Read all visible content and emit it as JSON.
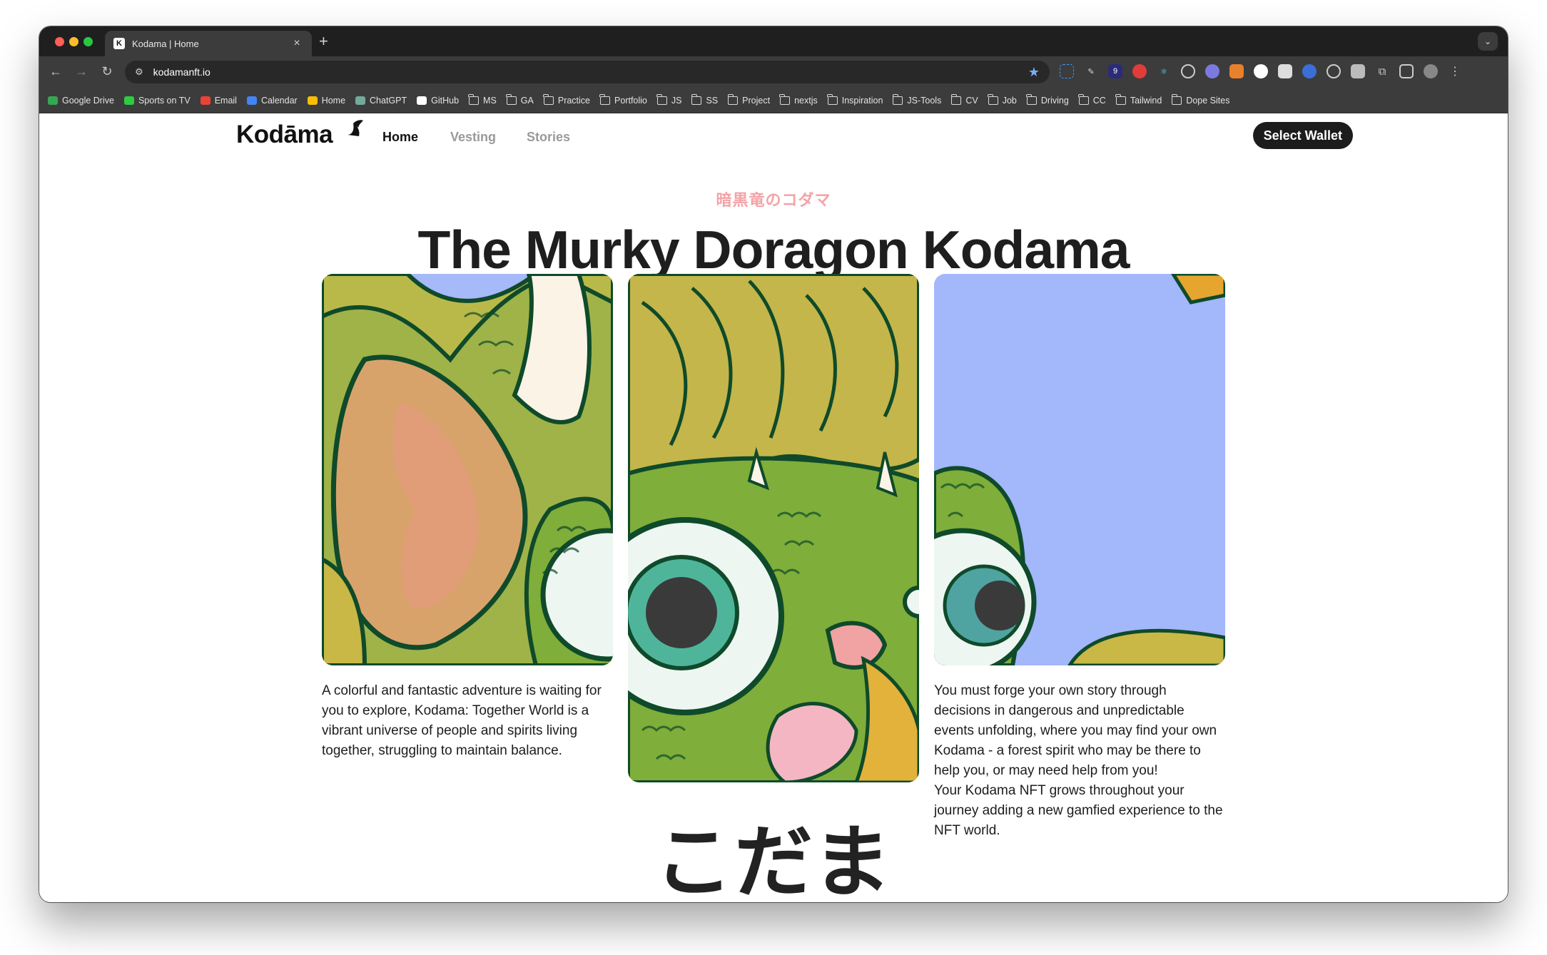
{
  "browser": {
    "tab_title": "Kodama | Home",
    "url": "kodamanft.io",
    "bookmarks": [
      {
        "label": "Google Drive",
        "icon": "google-drive-icon",
        "color": "#34a853"
      },
      {
        "label": "Sports on TV",
        "icon": "tv-icon",
        "color": "#2ecc40"
      },
      {
        "label": "Email",
        "icon": "gmail-icon",
        "color": "#ea4335"
      },
      {
        "label": "Calendar",
        "icon": "calendar-icon",
        "color": "#4285f4"
      },
      {
        "label": "Home",
        "icon": "maps-icon",
        "color": "#fbbc04"
      },
      {
        "label": "ChatGPT",
        "icon": "chatgpt-icon",
        "color": "#74aa9c"
      },
      {
        "label": "GitHub",
        "icon": "github-icon",
        "color": "#ffffff"
      },
      {
        "label": "MS",
        "icon": "folder-icon"
      },
      {
        "label": "GA",
        "icon": "folder-icon"
      },
      {
        "label": "Practice",
        "icon": "folder-icon"
      },
      {
        "label": "Portfolio",
        "icon": "folder-icon"
      },
      {
        "label": "JS",
        "icon": "folder-icon"
      },
      {
        "label": "SS",
        "icon": "folder-icon"
      },
      {
        "label": "Project",
        "icon": "folder-icon"
      },
      {
        "label": "nextjs",
        "icon": "folder-icon"
      },
      {
        "label": "Inspiration",
        "icon": "folder-icon"
      },
      {
        "label": "JS-Tools",
        "icon": "folder-icon"
      },
      {
        "label": "CV",
        "icon": "folder-icon"
      },
      {
        "label": "Job",
        "icon": "folder-icon"
      },
      {
        "label": "Driving",
        "icon": "folder-icon"
      },
      {
        "label": "CC",
        "icon": "folder-icon"
      },
      {
        "label": "Tailwind",
        "icon": "folder-icon"
      },
      {
        "label": "Dope Sites",
        "icon": "folder-icon"
      }
    ]
  },
  "site": {
    "logo": "Kodāma",
    "nav": {
      "home": "Home",
      "vesting": "Vesting",
      "stories": "Stories"
    },
    "wallet_button": "Select Wallet"
  },
  "hero": {
    "subtitle_jp": "暗黒竜のコダマ",
    "title": "The Murky Doragon Kodama"
  },
  "descriptions": {
    "left": "A colorful and fantastic adventure is waiting for you to explore, Kodama: Together World is a vibrant universe of people and spirits living together, struggling to maintain balance.",
    "right_1": "You must forge your own story through decisions in dangerous and unpredictable events unfolding, where you may find your own Kodama - a forest spirit who may be there to help you, or may need help from you!",
    "right_2": "Your Kodama NFT grows throughout your journey adding a new gamfied experience to the NFT world."
  },
  "kana_title": "こだま",
  "colors": {
    "accent_pink": "#f4a3a6",
    "panel_bg": "#a6b9f8",
    "dragon_green": "#7fae3a",
    "dragon_outline": "#0f4a2a",
    "eye_teal": "#4fb59a",
    "button_dark": "#1c1c1c"
  }
}
